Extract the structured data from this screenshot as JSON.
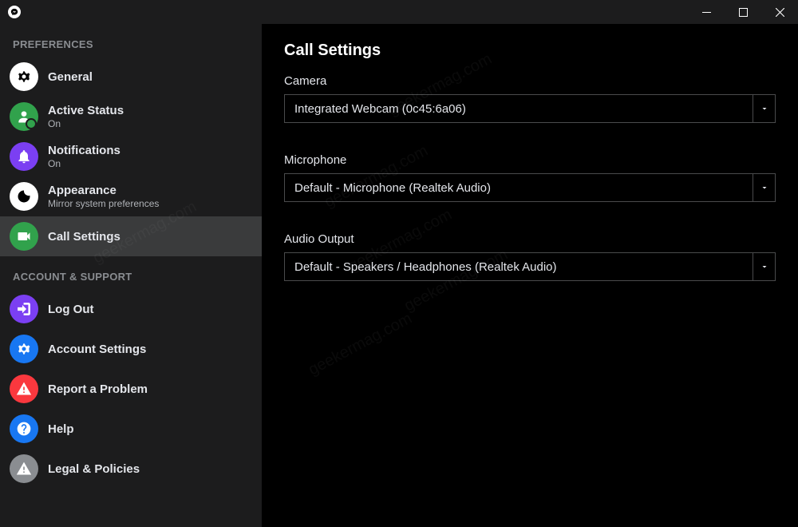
{
  "sidebar": {
    "section_preferences": "PREFERENCES",
    "section_account": "ACCOUNT & SUPPORT",
    "items": [
      {
        "label": "General",
        "sub": ""
      },
      {
        "label": "Active Status",
        "sub": "On"
      },
      {
        "label": "Notifications",
        "sub": "On"
      },
      {
        "label": "Appearance",
        "sub": "Mirror system preferences"
      },
      {
        "label": "Call Settings",
        "sub": ""
      },
      {
        "label": "Log Out",
        "sub": ""
      },
      {
        "label": "Account Settings",
        "sub": ""
      },
      {
        "label": "Report a Problem",
        "sub": ""
      },
      {
        "label": "Help",
        "sub": ""
      },
      {
        "label": "Legal & Policies",
        "sub": ""
      }
    ]
  },
  "main": {
    "title": "Call Settings",
    "camera": {
      "label": "Camera",
      "value": "Integrated Webcam (0c45:6a06)"
    },
    "microphone": {
      "label": "Microphone",
      "value": "Default - Microphone (Realtek Audio)"
    },
    "audio_output": {
      "label": "Audio Output",
      "value": "Default - Speakers / Headphones (Realtek Audio)"
    }
  },
  "watermark": "geekermag.com"
}
